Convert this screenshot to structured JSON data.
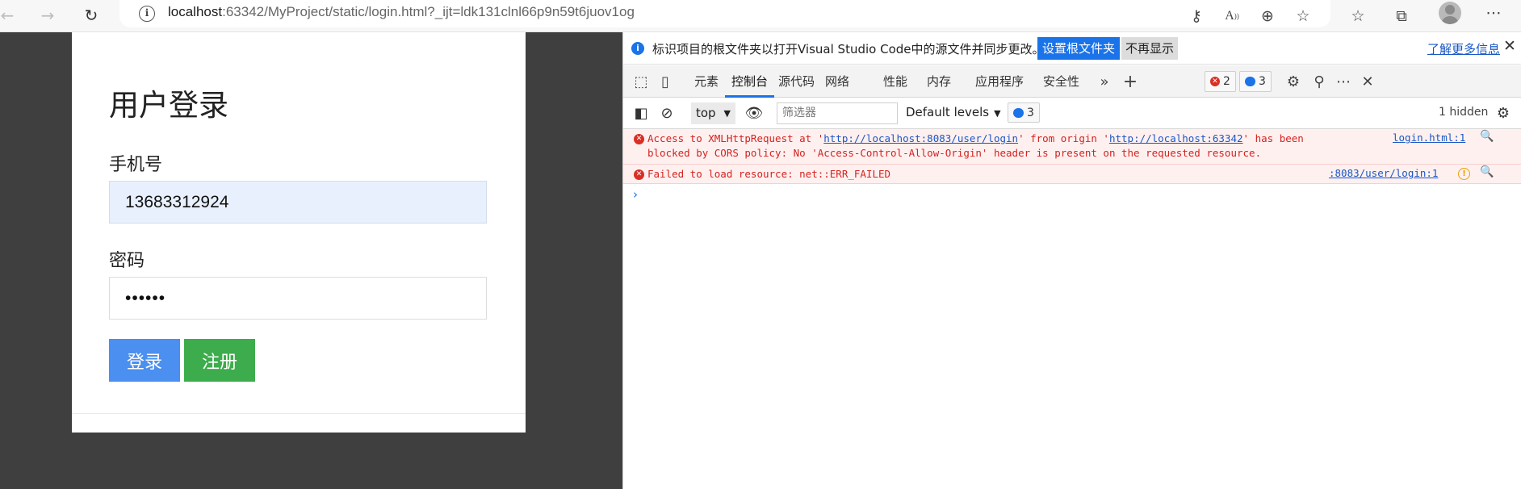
{
  "browser": {
    "url_host": "localhost",
    "url_rest": ":63342/MyProject/static/login.html?_ijt=ldk131clnl66p9n59t6juov1og"
  },
  "login": {
    "title": "用户登录",
    "phone_label": "手机号",
    "phone_value": "13683312924",
    "password_label": "密码",
    "password_value": "••••••",
    "login_button": "登录",
    "register_button": "注册"
  },
  "devtools": {
    "notice": {
      "message": "标识项目的根文件夹以打开Visual Studio Code中的源文件并同步更改。",
      "set_root_button": "设置根文件夹",
      "dont_show_button": "不再显示",
      "learn_more": "了解更多信息"
    },
    "tabs": [
      "元素",
      "控制台",
      "源代码",
      "网络",
      "性能",
      "内存",
      "应用程序",
      "安全性"
    ],
    "selected_tab": "控制台",
    "error_count": "2",
    "message_count": "3",
    "toolbar": {
      "context": "top",
      "filter_placeholder": "筛选器",
      "levels": "Default levels",
      "levels_count": "3",
      "hidden": "1 hidden"
    },
    "console": [
      {
        "text_a": "Access to XMLHttpRequest at '",
        "link1": "http://localhost:8083/user/login",
        "text_b": "' from origin '",
        "link2": "http://localhost:63342",
        "text_c": "' has been",
        "text_d": "blocked by CORS policy: No 'Access-Control-Allow-Origin' header is present on the requested resource.",
        "source": "login.html:1"
      },
      {
        "text": "Failed to load resource: net::ERR_FAILED",
        "source": ":8083/user/login:1"
      }
    ]
  },
  "colors": {
    "login_button": "#4b8ff0",
    "register_button": "#3dac4c",
    "error_text": "#d3231e",
    "accent": "#1a73e8"
  }
}
